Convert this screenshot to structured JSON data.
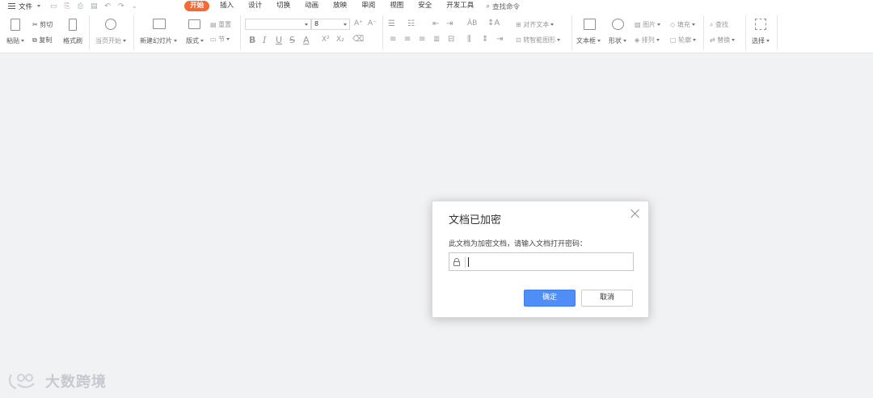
{
  "menubar": {
    "file_label": "文件",
    "tabs": [
      "开始",
      "插入",
      "设计",
      "切换",
      "动画",
      "放映",
      "审阅",
      "视图",
      "安全",
      "开发工具"
    ],
    "active_tab": "开始",
    "find_command": "查找命令"
  },
  "ribbon": {
    "paste": "粘贴",
    "cut": "剪切",
    "copy": "复制",
    "format_painter": "格式刷",
    "from_current": "当页开始",
    "new_slide": "新建幻灯片",
    "layout": "版式",
    "reset": "重置",
    "section": "节",
    "font_name": "",
    "font_size": "8",
    "bold": "B",
    "italic": "I",
    "underline": "U",
    "strike": "S",
    "font_color": "A",
    "superscript": "X²",
    "subscript": "X₂",
    "align_text": "对齐文本",
    "to_smartart": "转智能图形",
    "text_box": "文本框",
    "shape": "形状",
    "picture": "图片",
    "fill": "填充",
    "arrange": "排列",
    "outline": "轮廓",
    "find": "查找",
    "replace": "替换",
    "select": "选择"
  },
  "dialog": {
    "title": "文档已加密",
    "message": "此文档为加密文档，请输入文档打开密码：",
    "password_value": "",
    "ok_label": "确定",
    "cancel_label": "取消"
  },
  "watermark": {
    "text": "大数跨境"
  },
  "colors": {
    "active_tab": "#f06b37",
    "primary_button": "#4f8ef7",
    "canvas": "#f1f2f4"
  }
}
